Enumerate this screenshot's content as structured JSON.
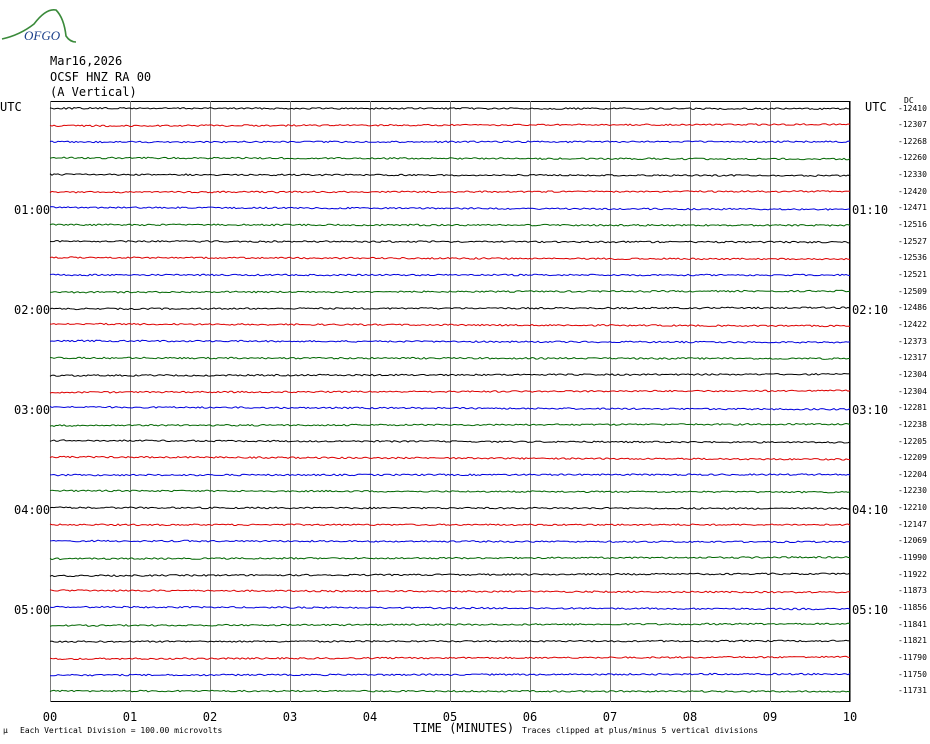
{
  "logo_text": "OFGO",
  "header": {
    "date": "Mar16,2026",
    "station": "OCSF HNZ RA 00",
    "component": "(A Vertical)"
  },
  "utc_left": "UTC",
  "utc_right": "UTC",
  "left_times": [
    "01:00",
    "02:00",
    "03:00",
    "04:00",
    "05:00"
  ],
  "right_times": [
    "01:10",
    "02:10",
    "03:10",
    "04:10",
    "05:10"
  ],
  "right_top_label": "DC",
  "right_values": [
    "-12410",
    "-12307",
    "-12268",
    "-12260",
    "-12330",
    "-12420",
    "-12471",
    "-12516",
    "-12527",
    "-12536",
    "-12521",
    "-12509",
    "-12486",
    "-12422",
    "-12373",
    "-12317",
    "-12304",
    "-12304",
    "-12281",
    "-12238",
    "-12205",
    "-12209",
    "-12204",
    "-12230",
    "-12210",
    "-12147",
    "-12069",
    "-11990",
    "-11922",
    "-11873",
    "-11856",
    "-11841",
    "-11821",
    "-11790",
    "-11750",
    "-11731"
  ],
  "footer": {
    "xlabel": "TIME (MINUTES)",
    "scale": "Each Vertical Division =  100.00 microvolts",
    "clip": "Traces clipped at plus/minus 5 vertical divisions",
    "mark": "μ"
  },
  "chart_data": {
    "type": "line",
    "title": "OCSF HNZ RA 00",
    "xlabel": "TIME (MINUTES)",
    "x_ticks": [
      "00",
      "01",
      "02",
      "03",
      "04",
      "05",
      "06",
      "07",
      "08",
      "09",
      "10"
    ],
    "xlim": [
      0,
      10
    ],
    "trace_count": 36,
    "trace_colors": [
      "#000000",
      "#dd0000",
      "#0000dd",
      "#006600"
    ],
    "grid": true,
    "trace_offsets_dc": [
      -12410,
      -12307,
      -12268,
      -12260,
      -12330,
      -12420,
      -12471,
      -12516,
      -12527,
      -12536,
      -12521,
      -12509,
      -12486,
      -12422,
      -12373,
      -12317,
      -12304,
      -12304,
      -12281,
      -12238,
      -12205,
      -12209,
      -12204,
      -12230,
      -12210,
      -12147,
      -12069,
      -11990,
      -11922,
      -11873,
      -11856,
      -11841,
      -11821,
      -11790,
      -11750,
      -11731
    ]
  }
}
